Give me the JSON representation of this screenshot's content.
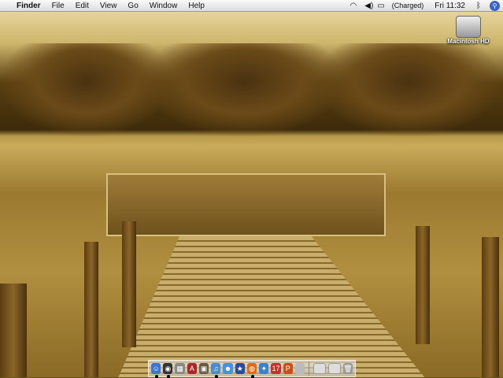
{
  "menubar": {
    "app": "Finder",
    "items": [
      "File",
      "Edit",
      "View",
      "Go",
      "Window",
      "Help"
    ],
    "battery": "(Charged)",
    "clock": "Fri 11:32"
  },
  "desktop": {
    "drive_label": "Macintosh HD"
  },
  "dock": {
    "apps": [
      {
        "name": "finder",
        "glyph": "☺",
        "color": "#3a74d8",
        "running": true
      },
      {
        "name": "dashboard",
        "glyph": "◉",
        "color": "#333",
        "running": true
      },
      {
        "name": "calculator",
        "glyph": "▦",
        "color": "#888",
        "running": false
      },
      {
        "name": "dictionary",
        "glyph": "A",
        "color": "#a8282a",
        "running": false
      },
      {
        "name": "iphoto",
        "glyph": "▣",
        "color": "#6a5a40",
        "running": false
      },
      {
        "name": "itunes",
        "glyph": "♫",
        "color": "#4a8ad8",
        "running": true
      },
      {
        "name": "ichat",
        "glyph": "☻",
        "color": "#4a90e0",
        "running": false
      },
      {
        "name": "imovie",
        "glyph": "★",
        "color": "#2a4aa0",
        "running": false
      },
      {
        "name": "firefox",
        "glyph": "◍",
        "color": "#e06a1a",
        "running": true
      },
      {
        "name": "safari",
        "glyph": "✦",
        "color": "#3a80d0",
        "running": false
      },
      {
        "name": "ical",
        "glyph": "17",
        "color": "#c83030",
        "running": false
      },
      {
        "name": "preview",
        "glyph": "P",
        "color": "#c8501a",
        "running": false
      },
      {
        "name": "system-preferences",
        "glyph": "",
        "color": "#bbb",
        "running": false
      }
    ],
    "minimized": [
      {
        "name": "minimized-window-1"
      },
      {
        "name": "minimized-window-2"
      }
    ],
    "trash": {
      "name": "trash",
      "glyph": "🗑"
    }
  }
}
